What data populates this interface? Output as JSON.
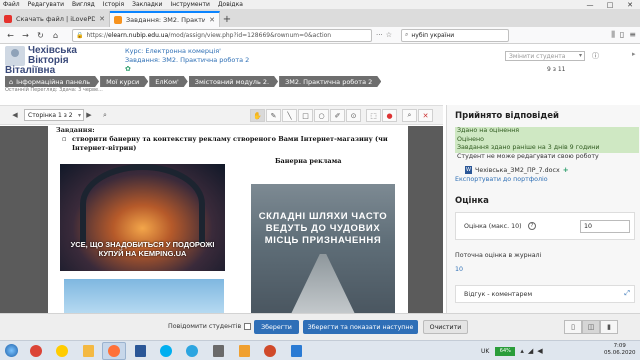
{
  "browser": {
    "menu": [
      "Файл",
      "Редагувати",
      "Вигляд",
      "Історія",
      "Закладки",
      "Інструменти",
      "Довідка"
    ],
    "tabs": [
      {
        "title": "Скачать файл | iLovePDF",
        "favicon_color": "#e5322d",
        "active": false
      },
      {
        "title": "Завдання: ЗМ2. Практична робота 2",
        "favicon_color": "#f7931e",
        "active": true
      }
    ],
    "url_prefix": "https://",
    "url_host": "elearn.nubip.edu.ua",
    "url_path": "/mod/assign/view.php?id=128669&rownum=0&action",
    "search_value": "нубіп україни",
    "window_controls": [
      "—",
      "□",
      "✕"
    ]
  },
  "moodle": {
    "user_name": [
      "Чехівська",
      "Вікторія",
      "Віталіївна"
    ],
    "course_line": "Курс: Електронна комерція'",
    "assignment_line": "Завдання: ЗМ2. Практична робота 2",
    "student_select_placeholder": "Змінити студента",
    "pager": "9 з 11",
    "breadcrumb": [
      "Інформаційна панель",
      "Мої курси",
      "ЕлКом'",
      "Змістовний модуль 2.",
      "ЗМ2. Практична робота 2"
    ],
    "subtext": "Останній Перегляд: Здача: 3 черве..."
  },
  "pdf_toolbar": {
    "page_select": "Сторінка 1 з 2",
    "tools": [
      "hand",
      "pen",
      "line",
      "rect",
      "oval",
      "stamp",
      "select",
      "highlight",
      "colour",
      "search",
      "delete"
    ]
  },
  "document": {
    "heading": "Завдання:",
    "bullet": "створити банерну та контекстну рекламу створеного Вами Інтернет-магазину (чи Інтернет-вітрин)",
    "banner_title": "Банерна реклама",
    "banner1_caption": "УСЕ, ЩО ЗНАДОБИТЬСЯ У ПОДОРОЖІ",
    "banner1_caption2": "КУПУЙ НА",
    "banner1_brand": "KEMPING.UA",
    "banner2_text": "СКЛАДНІ ШЛЯХИ ЧАСТО ВЕДУТЬ ДО ЧУДОВИХ МІСЦЬ ПРИЗНАЧЕННЯ"
  },
  "panel": {
    "title": "Прийнято відповідей",
    "status_lines": [
      "Здано на оцінення",
      "Оцінено",
      "Завдання здано раніше на 3 днів 9 години"
    ],
    "cannot_edit": "Студент не може редагувати свою роботу",
    "file_name": "Чехівська_ЗМ2_ПР_7.docx",
    "export_link": "Експортувати до портфоліо",
    "grade_title": "Оцінка",
    "grade_label": "Оцінка (макс. 10)",
    "grade_value": "10",
    "current_grade_label": "Поточна оцінка в журналі",
    "current_grade_value": "10",
    "feedback_label": "Відгук - коментарем"
  },
  "actions": {
    "notify_label": "Повідомити студентів",
    "save": "Зберегти",
    "save_next": "Зберегти та показати наступне",
    "reset": "Очистити"
  },
  "taskbar": {
    "lang": "UK",
    "battery": "64%",
    "time": "7:09",
    "date": "05.06.2020",
    "apps": [
      {
        "name": "chrome",
        "color": "#db4437",
        "active": false
      },
      {
        "name": "yandex",
        "color": "#ffcc00",
        "active": false
      },
      {
        "name": "explorer",
        "color": "#f4b942",
        "active": false
      },
      {
        "name": "firefox",
        "color": "#ff7139",
        "active": true
      },
      {
        "name": "word",
        "color": "#2b5797",
        "active": false
      },
      {
        "name": "skype",
        "color": "#00aff0",
        "active": false
      },
      {
        "name": "telegram",
        "color": "#2ca5e0",
        "active": false
      },
      {
        "name": "photos",
        "color": "#6a6a6a",
        "active": false
      },
      {
        "name": "mail",
        "color": "#f0a030",
        "active": false
      },
      {
        "name": "media",
        "color": "#d04a2a",
        "active": false
      },
      {
        "name": "tiles",
        "color": "#2a7bd4",
        "active": false
      }
    ]
  }
}
